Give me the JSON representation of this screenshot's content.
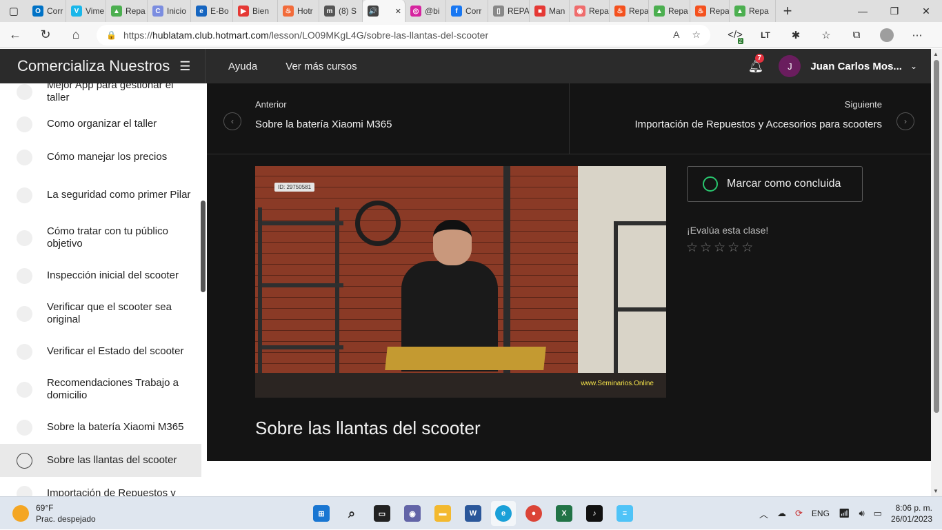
{
  "browser": {
    "tabs": [
      {
        "label": "Corr",
        "fav_color": "#0072c6",
        "fav_glyph": "O"
      },
      {
        "label": "Vime",
        "fav_color": "#1ab7ea",
        "fav_glyph": "V"
      },
      {
        "label": "Repa",
        "fav_color": "#4caf50",
        "fav_glyph": "▲"
      },
      {
        "label": "Inicio",
        "fav_color": "#7b8de0",
        "fav_glyph": "C"
      },
      {
        "label": "E-Bo",
        "fav_color": "#1565c0",
        "fav_glyph": "e"
      },
      {
        "label": "Bien",
        "fav_color": "#e53935",
        "fav_glyph": "▶"
      },
      {
        "label": "Hotr",
        "fav_color": "#f26b3a",
        "fav_glyph": "♨"
      },
      {
        "label": "(8) S",
        "fav_color": "#555555",
        "fav_glyph": "m"
      },
      {
        "label": "",
        "fav_color": "#444444",
        "fav_glyph": "🔊",
        "active": true
      },
      {
        "label": "@bi",
        "fav_color": "#d6249f",
        "fav_glyph": "◎"
      },
      {
        "label": "Corr",
        "fav_color": "#1877f2",
        "fav_glyph": "f"
      },
      {
        "label": "REPA",
        "fav_color": "#888888",
        "fav_glyph": "▯"
      },
      {
        "label": "Man",
        "fav_color": "#e53935",
        "fav_glyph": "■"
      },
      {
        "label": "Repa",
        "fav_color": "#ef6c6c",
        "fav_glyph": "◉"
      },
      {
        "label": "Repa",
        "fav_color": "#f4511e",
        "fav_glyph": "♨"
      },
      {
        "label": "Repa",
        "fav_color": "#4caf50",
        "fav_glyph": "▲"
      },
      {
        "label": "Repa",
        "fav_color": "#f4511e",
        "fav_glyph": "♨"
      },
      {
        "label": "Repa",
        "fav_color": "#4caf50",
        "fav_glyph": "▲"
      }
    ],
    "url_prefix": "https://",
    "url_host": "hublatam.club.hotmart.com",
    "url_path": "/lesson/LO09MKgL4G/sobre-las-llantas-del-scooter",
    "ext_badge": "2"
  },
  "header": {
    "course_title": "Comercializa Nuestros",
    "nav": [
      "Ayuda",
      "Ver más cursos"
    ],
    "notif_count": "7",
    "avatar_initial": "J",
    "user_name": "Juan Carlos Mos..."
  },
  "sidebar": {
    "lessons": [
      {
        "label": "Mejor App para gestionar el taller"
      },
      {
        "label": "Como organizar el taller"
      },
      {
        "label": "Cómo manejar los precios"
      },
      {
        "label": "La seguridad como primer Pilar"
      },
      {
        "label": "Cómo tratar con tu público objetivo"
      },
      {
        "label": "Inspección inicial del scooter"
      },
      {
        "label": "Verificar que el scooter sea original"
      },
      {
        "label": "Verificar el Estado del scooter"
      },
      {
        "label": "Recomendaciones Trabajo a domicilio"
      },
      {
        "label": "Sobre la batería Xiaomi M365"
      },
      {
        "label": "Sobre las llantas del scooter",
        "current": true
      },
      {
        "label": "Importación de Repuestos y"
      }
    ]
  },
  "lesson": {
    "prev_label": "Anterior",
    "prev_title": "Sobre la batería Xiaomi M365",
    "next_label": "Siguiente",
    "next_title": "Importación de Repuestos y Accesorios para scooters",
    "video_id": "ID: 29750581",
    "video_watermark": "www.Seminarios.Online",
    "title": "Sobre las llantas del scooter",
    "mark_done": "Marcar como concluida",
    "rate_label": "¡Evalúa esta clase!",
    "rating_stars": 5,
    "rating_value": 0
  },
  "taskbar": {
    "temp": "69°F",
    "weather": "Prac. despejado",
    "lang": "ENG",
    "time": "8:06 p. m.",
    "date": "26/01/2023"
  }
}
